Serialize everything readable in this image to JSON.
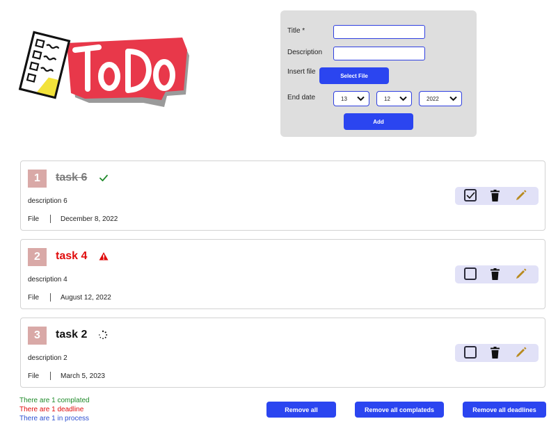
{
  "logo": {
    "text": "ToDo",
    "accent": "#e8384a"
  },
  "form": {
    "title_label": "Title *",
    "title_value": "",
    "description_label": "Description",
    "description_value": "",
    "file_label": "Insert file",
    "select_file_button": "Select File",
    "end_date_label": "End date",
    "day": "13",
    "month": "12",
    "year": "2022",
    "add_button": "Add"
  },
  "tasks": [
    {
      "number": "1",
      "title": "task 6",
      "status": "completed",
      "status_icon": "check-icon",
      "description": "description 6",
      "file": "File",
      "date": "December 8, 2022",
      "checked": true
    },
    {
      "number": "2",
      "title": "task 4",
      "status": "deadline",
      "status_icon": "warning-icon",
      "description": "description 4",
      "file": "File",
      "date": "August 12, 2022",
      "checked": false
    },
    {
      "number": "3",
      "title": "task 2",
      "status": "in-process",
      "status_icon": "spinner-icon",
      "description": "description 2",
      "file": "File",
      "date": "March 5, 2023",
      "checked": false
    }
  ],
  "summary": {
    "completed": "There are 1 complated",
    "deadline": "There are 1 deadline",
    "process": "There are 1 in process"
  },
  "buttons": {
    "remove_all": "Remove all",
    "remove_completed": "Remove all complateds",
    "remove_deadlines": "Remove all deadlines"
  },
  "colors": {
    "primary": "#2b45f0",
    "completed": "#1f8a2a",
    "deadline": "#e00b0b",
    "process": "#2d4fd0",
    "pencil": "#b88a1e"
  }
}
